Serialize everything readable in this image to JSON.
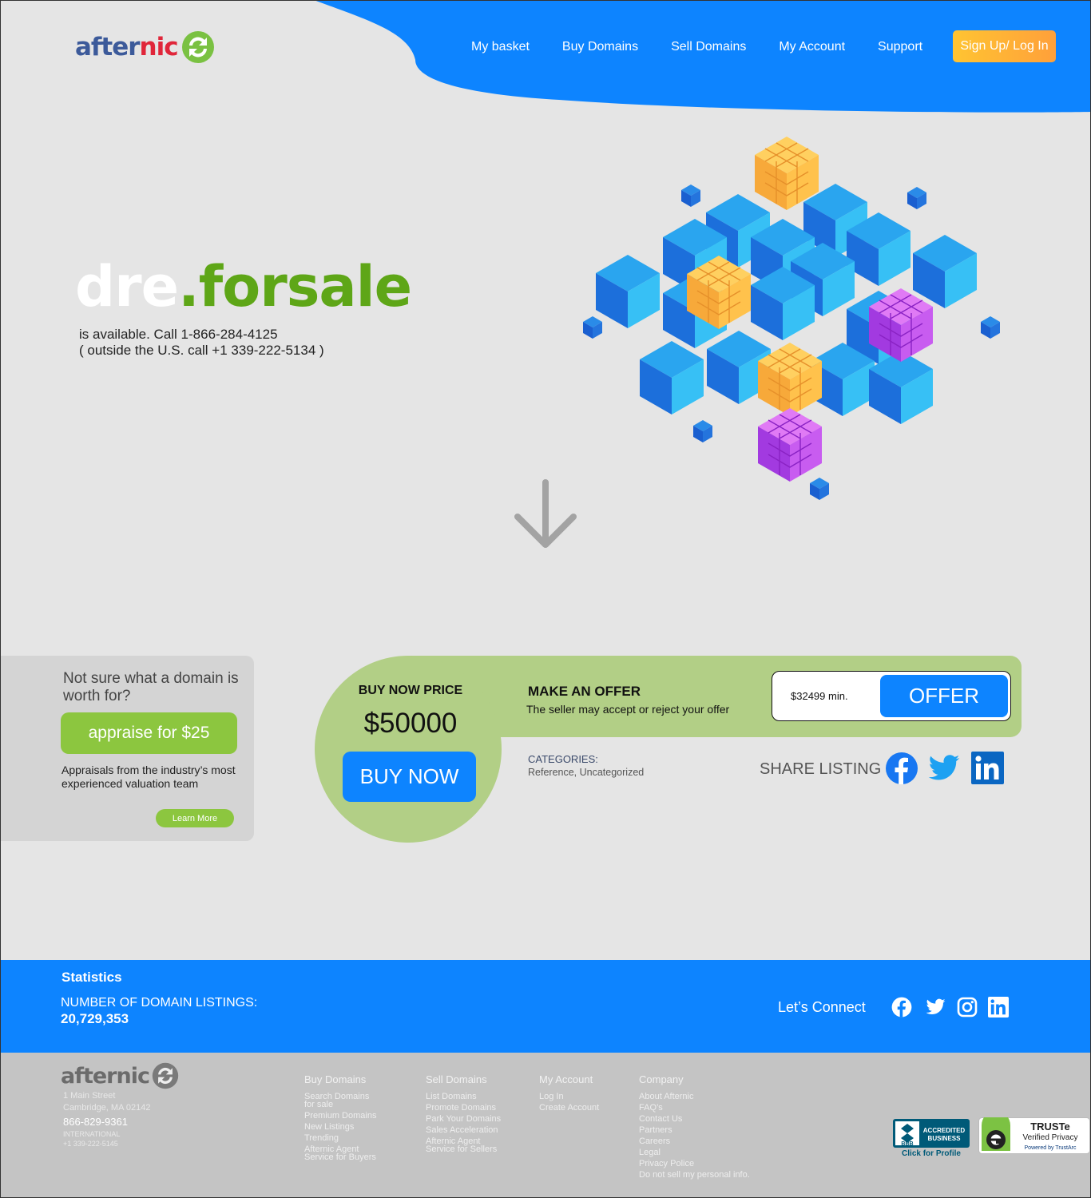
{
  "brand": {
    "logo_after": "after",
    "logo_nic": "nic",
    "accent": "#0d84ff",
    "green": "#8cc63f"
  },
  "nav": {
    "items": [
      "My basket",
      "Buy Domains",
      "Sell Domains",
      "My Account",
      "Support"
    ],
    "signup": "Sign Up/ Log In"
  },
  "hero": {
    "domain_name": "dre",
    "domain_tld": ".forsale",
    "availability": "is available. Call 1-866-284-4125",
    "outside_us": "( outside the U.S. call +1 339-222-5134 )"
  },
  "appraise": {
    "question": "Not sure what a domain is worth for?",
    "button": "appraise for $25",
    "description": "Appraisals from the industry’s most experienced valuation team",
    "learn_more": "Learn More"
  },
  "buy": {
    "label": "BUY NOW PRICE",
    "price": "$50000",
    "button": "BUY NOW"
  },
  "offer": {
    "title": "MAKE AN OFFER",
    "description": "The seller may accept or reject your offer",
    "placeholder": "$32499 min.",
    "button": "OFFER"
  },
  "categories": {
    "label": "CATEGORIES:",
    "value": "Reference, Uncategorized"
  },
  "share": {
    "label": "SHARE LISTING",
    "icons": [
      "facebook-icon",
      "twitter-icon",
      "linkedin-icon"
    ]
  },
  "stats": {
    "title": "Statistics",
    "label": "NUMBER OF DOMAIN LISTINGS:",
    "value": "20,729,353",
    "connect": "Let’s Connect"
  },
  "footer": {
    "logo_text": "afternic",
    "address_1": "1 Main Street",
    "address_2": "Cambridge, MA 02142",
    "phone": "866-829-9361",
    "intl_label": "INTERNATIONAL",
    "intl_phone": "+1 339-222-5145",
    "columns": [
      {
        "title": "Buy Domains",
        "links": [
          "Search Domains for sale",
          "Premium Domains",
          "New Listings",
          "Trending",
          "Afternic Agent Service for Buyers"
        ]
      },
      {
        "title": "Sell Domains",
        "links": [
          "List Domains",
          "Promote Domains",
          "Park Your Domains",
          "Sales Acceleration",
          "Afternic Agent Service for Sellers"
        ]
      },
      {
        "title": "My Account",
        "links": [
          "Log In",
          "Create Account"
        ]
      },
      {
        "title": "Company",
        "links": [
          "About Afternic",
          "FAQ’s",
          "Contact Us",
          "Partners",
          "Careers",
          "Legal",
          "Privacy Police",
          "Do not sell my personal info."
        ]
      }
    ],
    "bbb": {
      "line1": "ACCREDITED",
      "line2": "BUSINESS",
      "caption": "Click for Profile",
      "mark": "BBB"
    },
    "truste": {
      "title": "TRUSTe",
      "subtitle": "Verified Privacy",
      "powered": "Powered by TrustArc"
    }
  }
}
